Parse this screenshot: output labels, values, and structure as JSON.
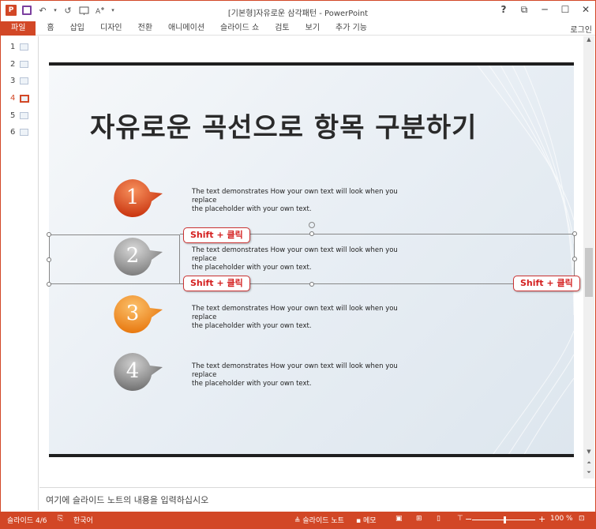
{
  "window": {
    "title": "[기본형]자유로운 삼각패턴 - PowerPoint",
    "controls": [
      "?",
      "⧉",
      "─",
      "☐",
      "✕"
    ]
  },
  "qat": {
    "app": "P",
    "undo": "↶",
    "redo": "↺",
    "more": "▾"
  },
  "ribbon": {
    "tabs": [
      "파일",
      "홈",
      "삽입",
      "디자인",
      "전환",
      "애니메이션",
      "슬라이드 쇼",
      "검토",
      "보기",
      "추가 기능"
    ],
    "login": "로그인"
  },
  "thumbnails": [
    "1",
    "2",
    "3",
    "4",
    "5",
    "6"
  ],
  "active_slide": 4,
  "slide": {
    "title": "자유로운 곡선으로 항목 구분하기",
    "items": [
      {
        "number": "1",
        "color": "#d9471c",
        "line1": "The text demonstrates How your own text will look when you replace",
        "line2": "the placeholder with your own text."
      },
      {
        "number": "2",
        "color": "#9a9a9a",
        "line1": "The text demonstrates How your own text will look when you replace",
        "line2": "the placeholder with your own text."
      },
      {
        "number": "3",
        "color": "#f08a1c",
        "line1": "The text demonstrates How your own text will look when you replace",
        "line2": "the placeholder with your own text."
      },
      {
        "number": "4",
        "color": "#8f8f8f",
        "line1": "The text demonstrates How your own text will look when you replace",
        "line2": "the placeholder with your own text."
      }
    ],
    "callouts": [
      "Shift + 클릭",
      "Shift + 클릭",
      "Shift + 클릭"
    ]
  },
  "notes": {
    "placeholder": "여기에 슬라이드 노트의 내용을 입력하십시오"
  },
  "status": {
    "slide_counter": "슬라이드 4/6",
    "language": "한국어",
    "notes_btn": "슬라이드 노트",
    "comments_btn": "메모",
    "zoom": "100 %",
    "zoom_minus": "−",
    "zoom_plus": "+"
  }
}
